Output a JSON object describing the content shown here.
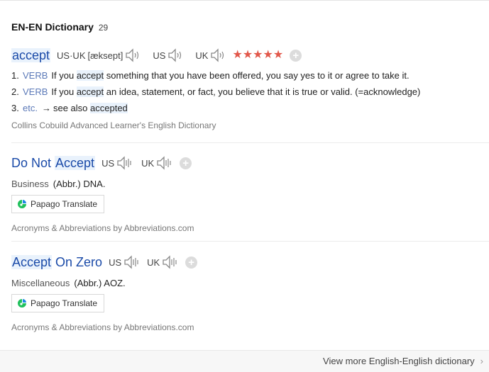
{
  "section": {
    "title": "EN-EN Dictionary",
    "count": "29"
  },
  "entries": [
    {
      "headword": "accept",
      "pronunciation": {
        "us_uk_label": "US·UK",
        "phonetic": "[æksept]",
        "us_label": "US",
        "uk_label": "UK"
      },
      "rating_stars": "★★★★★",
      "add_icon": "+",
      "senses": [
        {
          "num": "1.",
          "pos": "VERB",
          "pre": "If you",
          "hl": "accept",
          "post": "something that you have been offered, you say yes to it or agree to take it."
        },
        {
          "num": "2.",
          "pos": "VERB",
          "pre": "If you",
          "hl": "accept",
          "post": "an idea, statement, or fact, you believe that it is true or valid. (=acknowledge)"
        },
        {
          "num": "3.",
          "pos": "etc.",
          "arrow": "→",
          "pre": "see also",
          "hl": "accepted"
        }
      ],
      "source": "Collins Cobuild Advanced Learner's English Dictionary"
    },
    {
      "headword_parts": [
        "Do Not ",
        "Accept"
      ],
      "pronunciation": {
        "us_label": "US",
        "uk_label": "UK"
      },
      "add_icon": "+",
      "category": "Business",
      "abbr": "(Abbr.) DNA.",
      "papago_label": "Papago Translate",
      "source": "Acronyms & Abbreviations by Abbreviations.com"
    },
    {
      "headword_parts": [
        "Accept",
        " On Zero"
      ],
      "pronunciation": {
        "us_label": "US",
        "uk_label": "UK"
      },
      "add_icon": "+",
      "category": "Miscellaneous",
      "abbr": "(Abbr.) AOZ.",
      "papago_label": "Papago Translate",
      "source": "Acronyms & Abbreviations by Abbreviations.com"
    }
  ],
  "footer": {
    "more_label": "View more English-English dictionary",
    "chevron": "›"
  },
  "colors": {
    "headword": "#1a4aa8",
    "highlight": "#e9f2fc",
    "star": "#e2574a",
    "pos": "#5b79b8"
  }
}
